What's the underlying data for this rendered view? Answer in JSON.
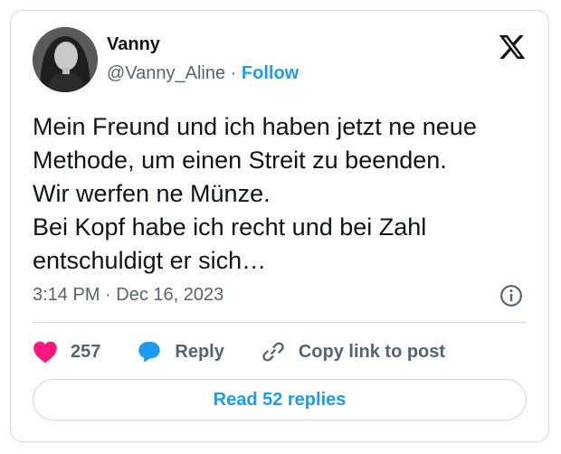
{
  "author": {
    "name": "Vanny",
    "handle": "@Vanny_Aline",
    "separator": "·",
    "follow_label": "Follow"
  },
  "tweet": {
    "lines": [
      "Mein Freund und ich haben jetzt ne neue",
      "Methode, um einen Streit zu beenden.",
      "Wir werfen ne Münze.",
      "Bei Kopf habe ich recht und bei Zahl",
      "entschuldigt er sich…"
    ],
    "time": "3:14 PM",
    "date": "Dec 16, 2023"
  },
  "actions": {
    "likes": "257",
    "reply_label": "Reply",
    "copy_label": "Copy link to post"
  },
  "read_replies_label": "Read 52 replies",
  "icons": [
    "x-logo-icon",
    "info-icon",
    "heart-icon",
    "reply-bubble-icon",
    "link-icon"
  ],
  "colors": {
    "accent": "#1d9bf0",
    "like": "#f91880",
    "text": "#0f1419",
    "muted": "#536471",
    "border": "#cfd9de"
  }
}
